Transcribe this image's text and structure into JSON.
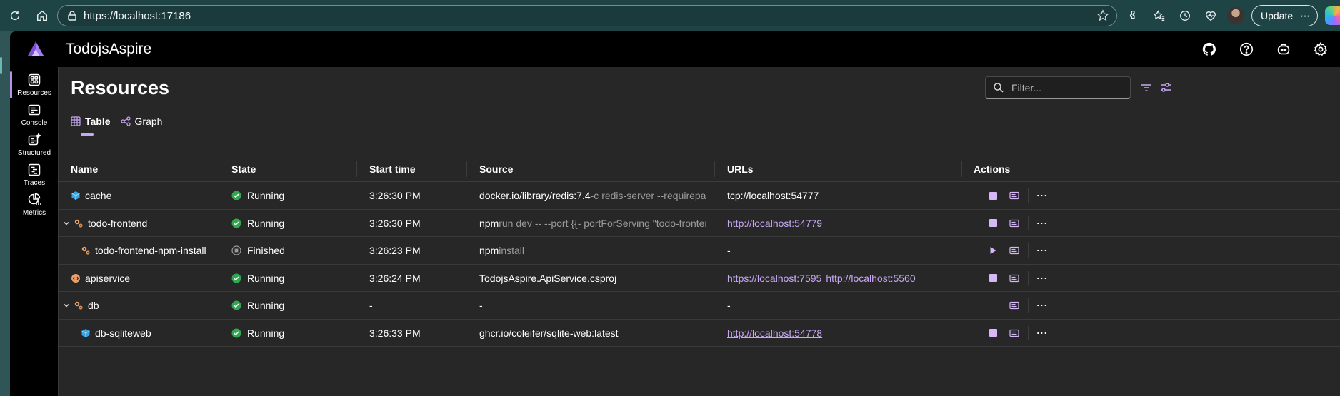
{
  "browser": {
    "url": "https://localhost:17186",
    "update_label": "Update"
  },
  "app": {
    "title": "TodojsAspire"
  },
  "sidenav": [
    {
      "label": "Resources",
      "icon": "resources-icon",
      "active": true
    },
    {
      "label": "Console",
      "icon": "console-icon",
      "active": false
    },
    {
      "label": "Structured",
      "icon": "structured-icon",
      "active": false
    },
    {
      "label": "Traces",
      "icon": "traces-icon",
      "active": false
    },
    {
      "label": "Metrics",
      "icon": "metrics-icon",
      "active": false
    }
  ],
  "page": {
    "title": "Resources",
    "filter_placeholder": "Filter..."
  },
  "view_tabs": [
    {
      "label": "Table",
      "active": true
    },
    {
      "label": "Graph",
      "active": false
    }
  ],
  "table": {
    "headers": [
      "Name",
      "State",
      "Start time",
      "Source",
      "URLs",
      "Actions"
    ],
    "rows": [
      {
        "name": "cache",
        "expandable": false,
        "indent": false,
        "icon": "container-icon",
        "state": "Running",
        "start": "3:26:30 PM",
        "source_main": "docker.io/library/redis:7.4",
        "source_args": " -c redis-server --requirepass $REDI...",
        "urls": [],
        "urls_plain": "tcp://localhost:54777",
        "primary_action": "stop"
      },
      {
        "name": "todo-frontend",
        "expandable": true,
        "indent": false,
        "icon": "executable-icon",
        "state": "Running",
        "start": "3:26:30 PM",
        "source_main": "npm",
        "source_args": " run dev -- --port {{- portForServing \"todo-frontend\" -}}",
        "urls": [
          "http://localhost:54779"
        ],
        "urls_plain": "",
        "primary_action": "stop"
      },
      {
        "name": "todo-frontend-npm-install",
        "expandable": false,
        "indent": true,
        "icon": "executable-icon",
        "state": "Finished",
        "start": "3:26:23 PM",
        "source_main": "npm",
        "source_args": " install",
        "urls": [],
        "urls_plain": "-",
        "primary_action": "start"
      },
      {
        "name": "apiservice",
        "expandable": false,
        "indent": false,
        "icon": "project-icon",
        "state": "Running",
        "start": "3:26:24 PM",
        "source_main": "TodojsAspire.ApiService.csproj",
        "source_args": "",
        "urls": [
          "https://localhost:7595",
          "http://localhost:5560"
        ],
        "urls_plain": "",
        "primary_action": "stop"
      },
      {
        "name": "db",
        "expandable": true,
        "indent": false,
        "icon": "executable-icon",
        "state": "Running",
        "start": "-",
        "source_main": "-",
        "source_args": "",
        "urls": [],
        "urls_plain": "-",
        "primary_action": "none"
      },
      {
        "name": "db-sqliteweb",
        "expandable": false,
        "indent": true,
        "icon": "container-icon",
        "state": "Running",
        "start": "3:26:33 PM",
        "source_main": "ghcr.io/coleifer/sqlite-web:latest",
        "source_args": "",
        "urls": [
          "http://localhost:54778"
        ],
        "urls_plain": "",
        "primary_action": "stop"
      }
    ]
  },
  "colors": {
    "accent": "#c9a7f5",
    "running": "#2fa84f",
    "finished": "#8a8a8a",
    "app_bg": "#272727",
    "header_bg": "#000000"
  }
}
